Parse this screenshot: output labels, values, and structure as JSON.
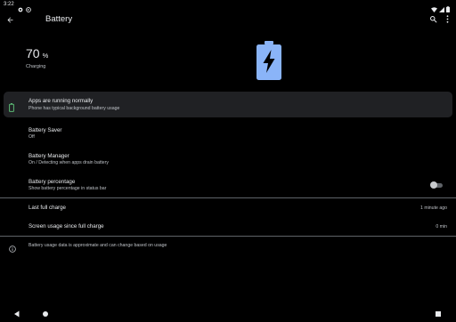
{
  "status_bar": {
    "time": "3:22",
    "battery_percent": ""
  },
  "app_bar": {
    "title": "Battery"
  },
  "battery": {
    "level": "70",
    "unit": "%",
    "status": "Charging",
    "level_fraction": 0.7
  },
  "tip": {
    "title": "Apps are running normally",
    "subtitle": "Phone has typical background battery usage"
  },
  "battery_saver": {
    "title": "Battery Saver",
    "subtitle": "Off"
  },
  "battery_manager": {
    "title": "Battery Manager",
    "subtitle": "On / Detecting when apps drain battery"
  },
  "battery_percentage": {
    "title": "Battery percentage",
    "subtitle": "Show battery percentage in status bar",
    "enabled": false
  },
  "last_full_charge": {
    "label": "Last full charge",
    "value": "1 minute ago"
  },
  "screen_usage": {
    "label": "Screen usage since full charge",
    "value": "0 min"
  },
  "footnote": "Battery usage data is approximate and can change based on usage",
  "colors": {
    "accent": "#8ab4f8",
    "tip_icon": "#5bb974",
    "background": "#000000",
    "card": "#202124"
  },
  "icons": [
    "back-arrow",
    "search",
    "more-vert",
    "battery-charging",
    "battery-ok",
    "info",
    "nav-back",
    "nav-home",
    "nav-recents"
  ]
}
